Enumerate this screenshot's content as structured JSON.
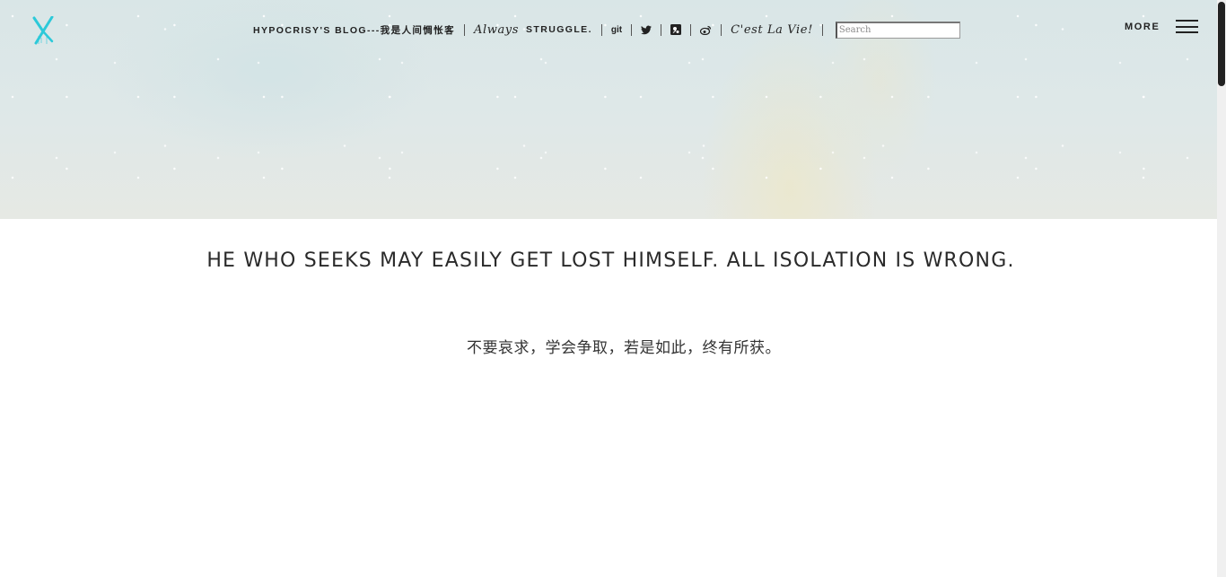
{
  "header": {
    "blog_title": "HYPOCRISY'S BLOG---我是人间惆怅客",
    "motto_italic": "Always",
    "motto_caps": "STRUGGLE.",
    "git_label": "git",
    "tagline": "C'est La Vie!",
    "search_placeholder": "Search",
    "more_label": "MORE"
  },
  "icons": {
    "logo": "x-logo-icon",
    "twitter": "twitter-icon",
    "social": "social-icon",
    "weibo": "weibo-icon",
    "menu": "hamburger-menu-icon"
  },
  "colors": {
    "logo_accent": "#2cc9d9",
    "text": "#222222"
  },
  "main": {
    "headline": "HE WHO SEEKS MAY EASILY GET LOST HIMSELF. ALL ISOLATION IS WRONG.",
    "subline": "不要哀求，学会争取，若是如此，终有所获。"
  }
}
